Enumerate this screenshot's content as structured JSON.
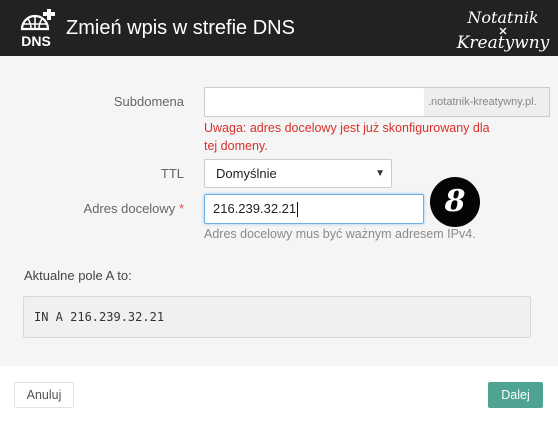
{
  "dialog": {
    "logo_text": "DNS",
    "title": "Zmień wpis w strefie DNS",
    "watermark_line1": "Notatnik",
    "watermark_line2": "Kreatywny"
  },
  "form": {
    "subdomain_label": "Subdomena",
    "subdomain_value": "",
    "subdomain_suffix": ".notatnik-kreatywny.pl.",
    "warning_text": "Uwaga: adres docelowy jest już skonfigurowany dla tej domeny.",
    "ttl_label": "TTL",
    "ttl_selected": "Domyślnie",
    "target_label": "Adres docelowy",
    "target_required_mark": "*",
    "target_value": "216.239.32.21",
    "target_helper": "Adres docelowy mus być ważnym adresem IPv4."
  },
  "annotation": {
    "step_number": "8"
  },
  "current": {
    "label": "Aktualne pole A to:",
    "record": "IN A 216.239.32.21"
  },
  "footer": {
    "cancel_label": "Anuluj",
    "next_label": "Dalej"
  },
  "colors": {
    "titlebar": "#222222",
    "warning": "#d9302b",
    "primary_button": "#4ea392",
    "focus_border": "#66afe9"
  },
  "icons": {
    "logo": "dns-globe-plus-icon",
    "select_caret": "caret-down-icon"
  }
}
